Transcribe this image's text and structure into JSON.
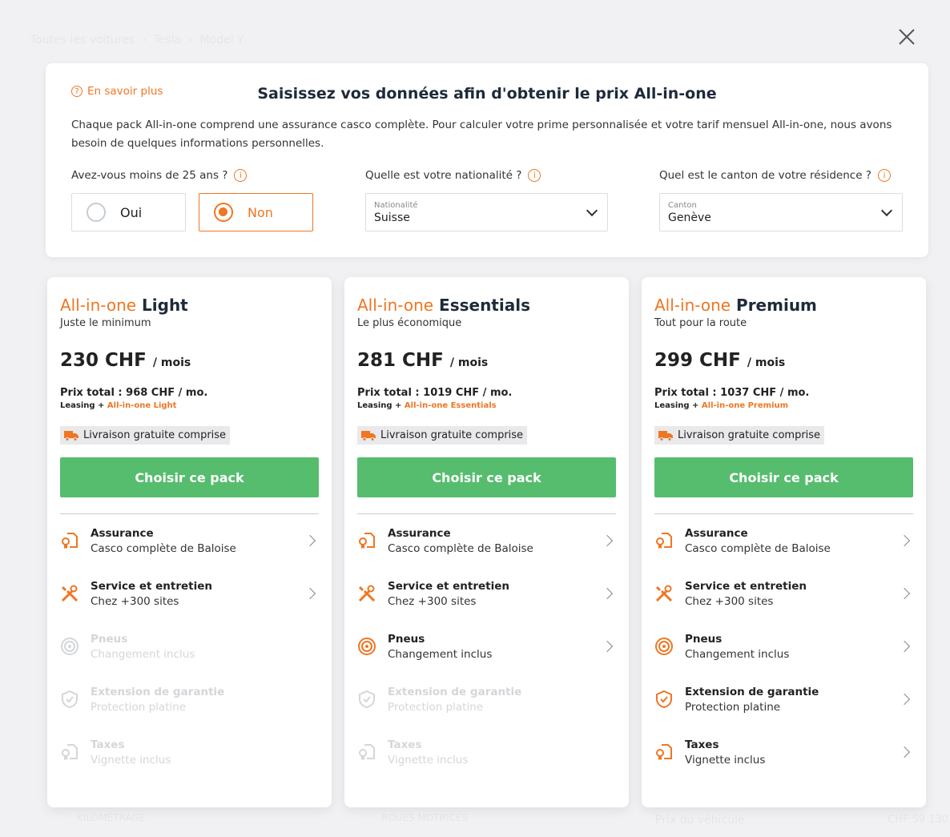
{
  "background": {
    "breadcrumb": [
      "Toutes les voitures",
      "Tesla",
      "Model Y"
    ],
    "kilometrage": "KILOMETRAGE",
    "roues": "ROUES MOTRICES",
    "prix_label": "Prix du véhicule",
    "prix_value": "CHF 59 130"
  },
  "modal": {
    "learn_more": "En savoir plus",
    "title": "Saisissez vos données afin d'obtenir le prix All-in-one",
    "description": "Chaque pack All-in-one comprend une assurance casco complète. Pour calculer votre prime personnalisée et votre tarif mensuel All-in-one, nous avons besoin de quelques informations personnelles.",
    "age_question": "Avez-vous moins de 25 ans ?",
    "age_options": [
      "Oui",
      "Non"
    ],
    "age_selected": "Non",
    "nationality_question": "Quelle est votre nationalité ?",
    "nationality": {
      "label": "Nationalité",
      "value": "Suisse"
    },
    "canton_question": "Quel est le canton de votre résidence ?",
    "canton": {
      "label": "Canton",
      "value": "Genève"
    }
  },
  "accent": "#ef7622",
  "cta_color": "#56bd6e",
  "cards": [
    {
      "brand": "All-in-one",
      "name": "Light",
      "subtitle": "Juste le minimum",
      "price": "230 CHF",
      "per": "/ mois",
      "total": "Prix total : 968 CHF / mo.",
      "lease_prefix": "Leasing +",
      "lease_pack": "All-in-one Light",
      "badge": "Livraison gratuite comprise",
      "cta": "Choisir ce pack"
    },
    {
      "brand": "All-in-one",
      "name": "Essentials",
      "subtitle": "Le plus économique",
      "price": "281 CHF",
      "per": "/ mois",
      "total": "Prix total : 1019 CHF / mo.",
      "lease_prefix": "Leasing +",
      "lease_pack": "All-in-one Essentials",
      "badge": "Livraison gratuite comprise",
      "cta": "Choisir ce pack"
    },
    {
      "brand": "All-in-one",
      "name": "Premium",
      "subtitle": "Tout pour la route",
      "price": "299 CHF",
      "per": "/ mois",
      "total": "Prix total : 1037 CHF / mo.",
      "lease_prefix": "Leasing +",
      "lease_pack": "All-in-one Premium",
      "badge": "Livraison gratuite comprise",
      "cta": "Choisir ce pack"
    }
  ],
  "features": [
    {
      "icon": "insurance-document-icon",
      "title": "Assurance",
      "desc": "Casco complète de Baloise"
    },
    {
      "icon": "tools-icon",
      "title": "Service et entretien",
      "desc": "Chez +300 sites"
    },
    {
      "icon": "tire-icon",
      "title": "Pneus",
      "desc": "Changement inclus"
    },
    {
      "icon": "shield-check-icon",
      "title": "Extension de garantie",
      "desc": "Protection platine"
    },
    {
      "icon": "tax-document-icon",
      "title": "Taxes",
      "desc": "Vignette inclus"
    }
  ],
  "included": [
    [
      true,
      true,
      false,
      false,
      false
    ],
    [
      true,
      true,
      true,
      false,
      false
    ],
    [
      true,
      true,
      true,
      true,
      true
    ]
  ]
}
